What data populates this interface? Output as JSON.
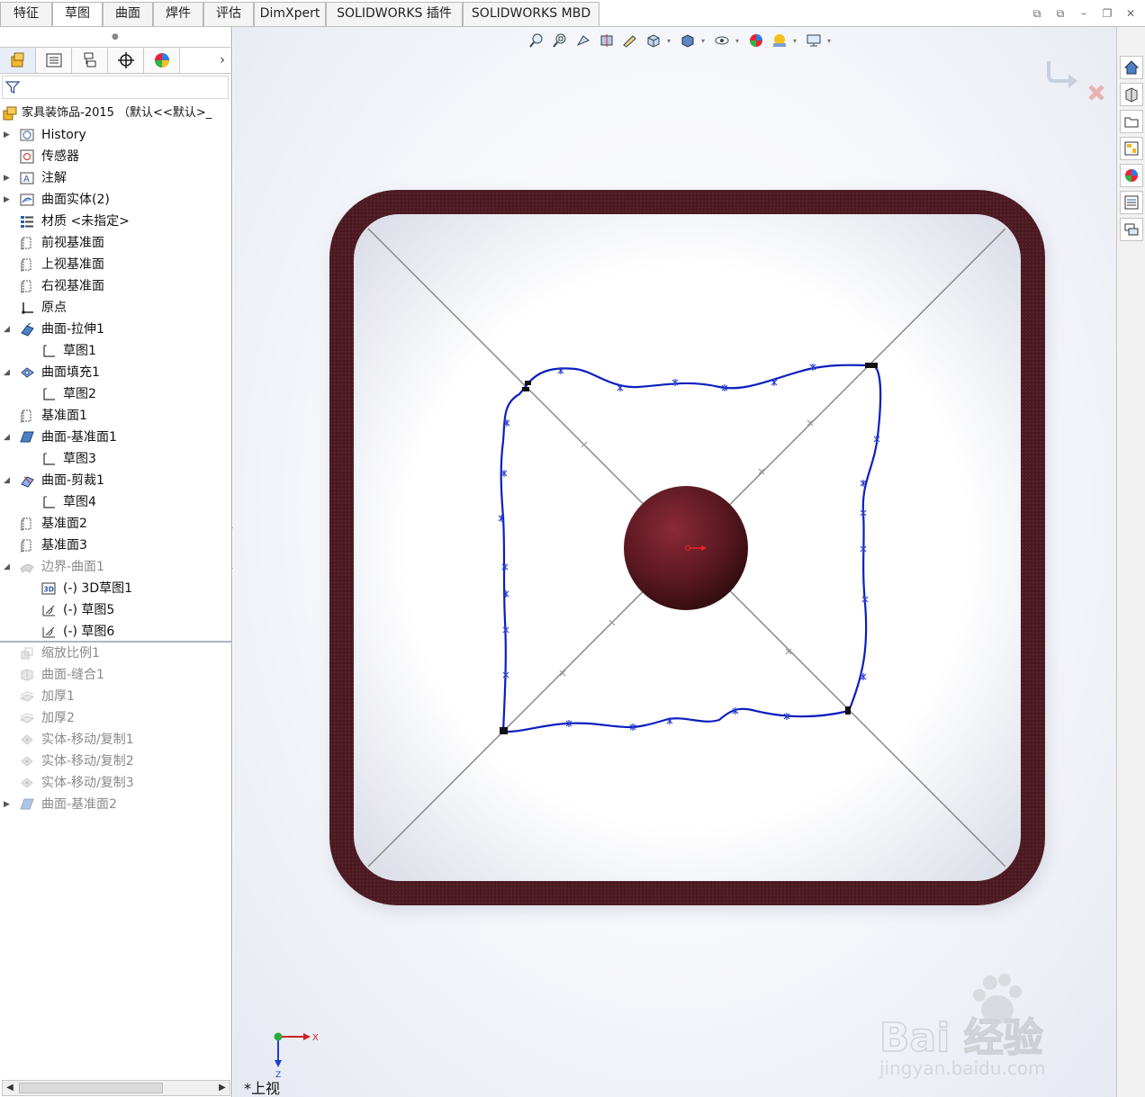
{
  "command_tabs": [
    "特征",
    "草图",
    "曲面",
    "焊件",
    "评估",
    "DimXpert",
    "SOLIDWORKS 插件",
    "SOLIDWORKS MBD"
  ],
  "active_tab": "草图",
  "feature_tree": {
    "root": "家具装饰品-2015  （默认<<默认>_",
    "items": [
      {
        "label": "History",
        "icon": "history-folder-icon",
        "expander": true,
        "indent": 0,
        "dim": false
      },
      {
        "label": "传感器",
        "icon": "sensor-icon",
        "expander": false,
        "indent": 0,
        "dim": false
      },
      {
        "label": "注解",
        "icon": "annotation-icon",
        "expander": true,
        "indent": 0,
        "dim": false
      },
      {
        "label": "曲面实体(2)",
        "icon": "surface-bodies-icon",
        "expander": true,
        "indent": 0,
        "dim": false
      },
      {
        "label": "材质 <未指定>",
        "icon": "material-icon",
        "expander": false,
        "indent": 0,
        "dim": false
      },
      {
        "label": "前视基准面",
        "icon": "plane-icon",
        "expander": false,
        "indent": 0,
        "dim": false
      },
      {
        "label": "上视基准面",
        "icon": "plane-icon",
        "expander": false,
        "indent": 0,
        "dim": false
      },
      {
        "label": "右视基准面",
        "icon": "plane-icon",
        "expander": false,
        "indent": 0,
        "dim": false
      },
      {
        "label": "原点",
        "icon": "origin-icon",
        "expander": false,
        "indent": 0,
        "dim": false
      },
      {
        "label": "曲面-拉伸1",
        "icon": "surface-extrude-icon",
        "expander": true,
        "expanded": true,
        "indent": 0,
        "dim": false
      },
      {
        "label": "草图1",
        "icon": "sketch-icon",
        "expander": false,
        "indent": 1,
        "dim": false
      },
      {
        "label": "曲面填充1",
        "icon": "surface-fill-icon",
        "expander": true,
        "expanded": true,
        "indent": 0,
        "dim": false
      },
      {
        "label": "草图2",
        "icon": "sketch-icon",
        "expander": false,
        "indent": 1,
        "dim": false
      },
      {
        "label": "基准面1",
        "icon": "plane-icon",
        "expander": false,
        "indent": 0,
        "dim": false
      },
      {
        "label": "曲面-基准面1",
        "icon": "planar-surface-icon",
        "expander": true,
        "expanded": true,
        "indent": 0,
        "dim": false
      },
      {
        "label": "草图3",
        "icon": "sketch-icon",
        "expander": false,
        "indent": 1,
        "dim": false
      },
      {
        "label": "曲面-剪裁1",
        "icon": "surface-trim-icon",
        "expander": true,
        "expanded": true,
        "indent": 0,
        "dim": false
      },
      {
        "label": "草图4",
        "icon": "sketch-icon",
        "expander": false,
        "indent": 1,
        "dim": false
      },
      {
        "label": "基准面2",
        "icon": "plane-icon",
        "expander": false,
        "indent": 0,
        "dim": false
      },
      {
        "label": "基准面3",
        "icon": "plane-icon",
        "expander": false,
        "indent": 0,
        "dim": false
      },
      {
        "label": "边界-曲面1",
        "icon": "boundary-surface-icon",
        "expander": true,
        "expanded": true,
        "indent": 0,
        "dim": true
      },
      {
        "label": "(-)   3D草图1",
        "icon": "3d-sketch-icon",
        "expander": false,
        "indent": 1,
        "dim": false
      },
      {
        "label": "(-)   草图5",
        "icon": "sketch-plane-icon",
        "expander": false,
        "indent": 1,
        "dim": false
      },
      {
        "label": "(-)   草图6",
        "icon": "sketch-plane-icon",
        "expander": false,
        "indent": 1,
        "dim": false
      },
      {
        "label": "缩放比例1",
        "icon": "scale-icon",
        "expander": false,
        "indent": 0,
        "dim": true
      },
      {
        "label": "曲面-缝合1",
        "icon": "knit-icon",
        "expander": false,
        "indent": 0,
        "dim": true
      },
      {
        "label": "加厚1",
        "icon": "thicken-icon",
        "expander": false,
        "indent": 0,
        "dim": true
      },
      {
        "label": "加厚2",
        "icon": "thicken-icon",
        "expander": false,
        "indent": 0,
        "dim": true
      },
      {
        "label": "实体-移动/复制1",
        "icon": "move-copy-icon",
        "expander": false,
        "indent": 0,
        "dim": true
      },
      {
        "label": "实体-移动/复制2",
        "icon": "move-copy-icon",
        "expander": false,
        "indent": 0,
        "dim": true
      },
      {
        "label": "实体-移动/复制3",
        "icon": "move-copy-icon",
        "expander": false,
        "indent": 0,
        "dim": true
      },
      {
        "label": "曲面-基准面2",
        "icon": "planar-surface-icon",
        "expander": true,
        "indent": 0,
        "dim": true
      }
    ]
  },
  "viewport": {
    "view_name": "*上视",
    "triad_x": "X",
    "triad_z": "Z",
    "watermark_text": "Bai 经验",
    "watermark_url": "jingyan.baidu.com"
  },
  "colors": {
    "frame": "#4a1a22",
    "sphere": "#6a1e28",
    "curve": "#0a1fbf",
    "construction": "#8a8a8a"
  }
}
